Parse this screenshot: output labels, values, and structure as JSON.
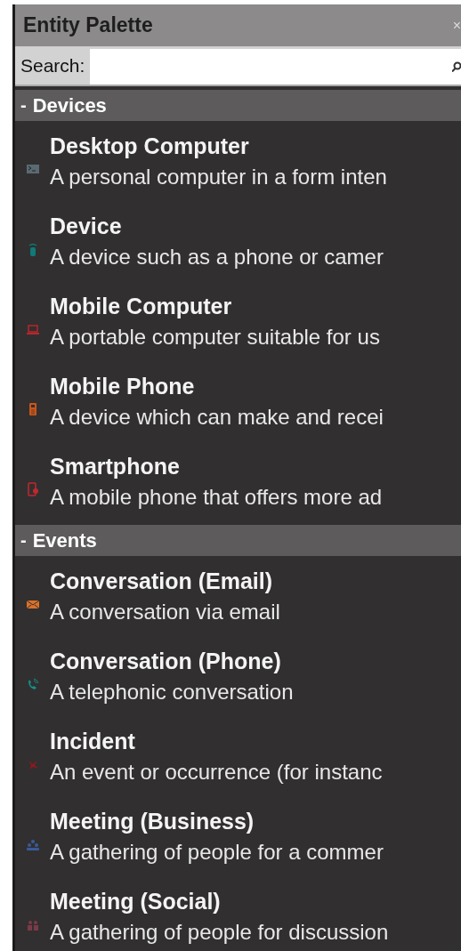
{
  "window": {
    "title": "Entity Palette",
    "close": "×"
  },
  "search": {
    "label": "Search:"
  },
  "categories": [
    {
      "name": "Devices",
      "toggle": "-",
      "expanded": true,
      "items": [
        {
          "kind": "terminal",
          "title": "Desktop Computer",
          "description": "A personal computer in a form inten",
          "color": "#5a6a72"
        },
        {
          "kind": "sensor",
          "title": "Device",
          "description": "A device such as a phone or camer",
          "color": "#0f7a78"
        },
        {
          "kind": "laptop",
          "title": "Mobile Computer",
          "description": "A portable computer suitable for us",
          "color": "#b8262b"
        },
        {
          "kind": "phone",
          "title": "Mobile Phone",
          "description": "A device which can make and recei",
          "color": "#c8561a"
        },
        {
          "kind": "smartphone",
          "title": "Smartphone",
          "description": "A mobile phone that offers more ad",
          "color": "#c0282e"
        }
      ]
    },
    {
      "name": "Events",
      "toggle": "-",
      "expanded": true,
      "items": [
        {
          "kind": "envelope",
          "title": "Conversation (Email)",
          "description": "A conversation via email",
          "color": "#d9722a"
        },
        {
          "kind": "call",
          "title": "Conversation (Phone)",
          "description": "A telephonic conversation",
          "color": "#13908a"
        },
        {
          "kind": "incident",
          "title": "Incident",
          "description": "An event or occurrence (for instanc",
          "color": "#8a1a1e"
        },
        {
          "kind": "group",
          "title": "Meeting (Business)",
          "description": "A gathering of people for a commer",
          "color": "#3a5a9a"
        },
        {
          "kind": "social",
          "title": "Meeting (Social)",
          "description": "A gathering of people for discussion",
          "color": "#7a3a48"
        }
      ]
    }
  ]
}
